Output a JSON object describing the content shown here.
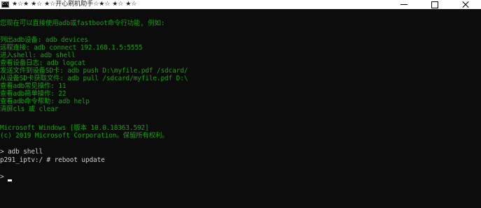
{
  "window": {
    "title": "★☆★ ★☆ ★☆开心刷机助手☆★☆ ★☆ ★☆",
    "app_icon": "C:\\"
  },
  "colors": {
    "background": "#0c0c0c",
    "green_text": "#13a10e",
    "white_text": "#cccccc",
    "titlebar": "#ffffff"
  },
  "console": {
    "intro": "您现在可以直接使用adb或fastboot命令行功能, 例如:",
    "examples": [
      "列出adb设备: adb devices",
      "远程连接: adb connect 192.168.1.5:5555",
      "进入shell: adb shell",
      "查看设备日志: adb logcat",
      "发送文件到设备SD卡: adb push D:\\myfile.pdf /sdcard/",
      "从设备SD卡获取文件: adb pull /sdcard/myfile.pdf D:\\",
      "查看adb常见操作: 11",
      "查看adb简单操作: 22",
      "查看adb命令帮助: adb help",
      "清屏cls 或 clear"
    ],
    "windows_version": "Microsoft Windows [版本 10.0.18363.592]",
    "copyright": "(c) 2019 Microsoft Corporation。保留所有权利。",
    "cmd_adb_shell": "> adb shell",
    "cmd_reboot": "p291_iptv:/ # reboot update",
    "prompt": ">"
  }
}
